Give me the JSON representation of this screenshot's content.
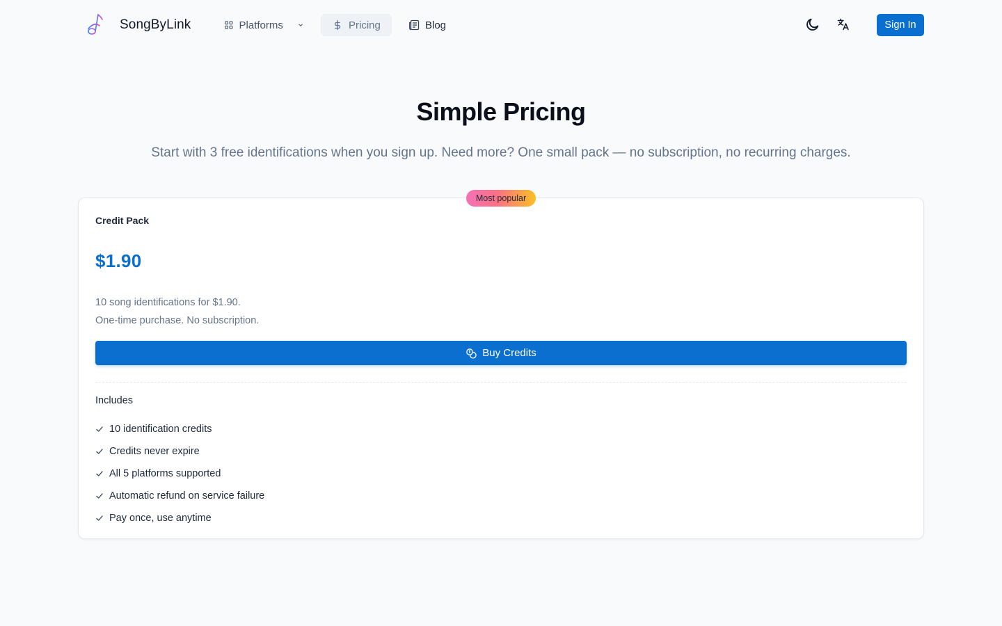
{
  "header": {
    "logo_text": "SongByLink",
    "nav": [
      {
        "label": "Platforms",
        "icon": "grid-icon"
      },
      {
        "label": "Pricing",
        "icon": "dollar-icon"
      },
      {
        "label": "Blog",
        "icon": "newspaper-icon"
      }
    ],
    "sign_in_label": "Sign In"
  },
  "hero": {
    "title": "Simple Pricing",
    "subtitle": "Start with 3 free identifications when you sign up. Need more? One small pack — no subscription, no recurring charges."
  },
  "card": {
    "badge": "Most popular",
    "plan_name": "Credit Pack",
    "price": "$1.90",
    "desc_line1": "10 song identifications for $1.90.",
    "desc_line2": "One-time purchase. No subscription.",
    "buy_label": "Buy Credits",
    "includes_label": "Includes",
    "features": [
      "10 identification credits",
      "Credits never expire",
      "All 5 platforms supported",
      "Automatic refund on service failure",
      "Pay once, use anytime"
    ]
  },
  "colors": {
    "accent": "#0b6fd0",
    "background": "#f8fafc",
    "badge_gradient": [
      "#f472b6",
      "#fb7185",
      "#fbbf24"
    ]
  }
}
